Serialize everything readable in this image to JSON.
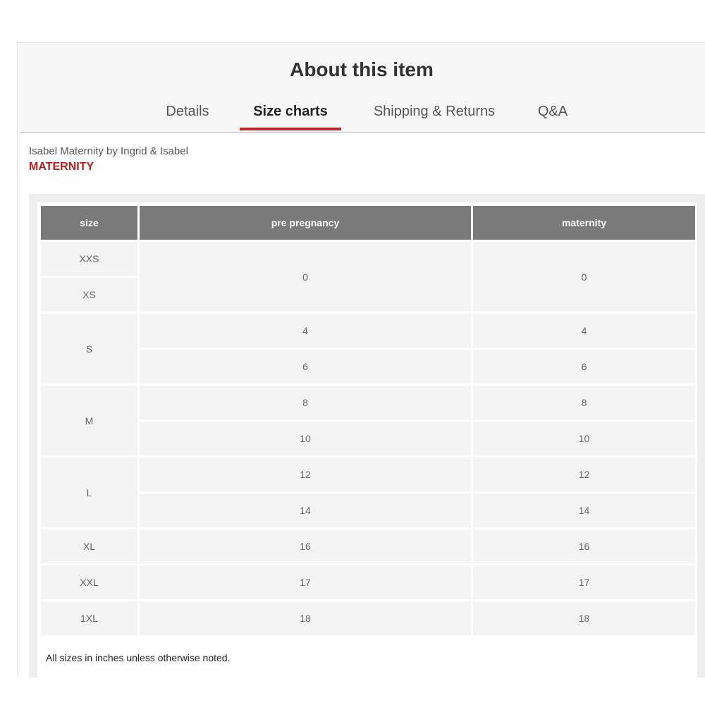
{
  "header": {
    "title": "About this item"
  },
  "tabs": [
    {
      "label": "Details",
      "active": false
    },
    {
      "label": "Size charts",
      "active": true
    },
    {
      "label": "Shipping & Returns",
      "active": false
    },
    {
      "label": "Q&A",
      "active": false
    }
  ],
  "colors": {
    "accent": "#c62828",
    "category": "#b71c1c",
    "table_header": "#7a7a7a",
    "table_cell": "#f3f3f3"
  },
  "product": {
    "brand": "Isabel Maternity by Ingrid & Isabel",
    "category": "MATERNITY"
  },
  "size_chart": {
    "columns": [
      "size",
      "pre pregnancy",
      "maternity"
    ],
    "rows": {
      "xxs": {
        "size": "XXS"
      },
      "xs": {
        "size": "XS"
      },
      "xxs_xs_pre": "0",
      "xxs_xs_mat": "0",
      "s": {
        "size": "S",
        "pre_1": "4",
        "mat_1": "4",
        "pre_2": "6",
        "mat_2": "6"
      },
      "m": {
        "size": "M",
        "pre_1": "8",
        "mat_1": "8",
        "pre_2": "10",
        "mat_2": "10"
      },
      "l": {
        "size": "L",
        "pre_1": "12",
        "mat_1": "12",
        "pre_2": "14",
        "mat_2": "14"
      },
      "xl": {
        "size": "XL",
        "pre": "16",
        "mat": "16"
      },
      "xxl": {
        "size": "XXL",
        "pre": "17",
        "mat": "17"
      },
      "x1xl": {
        "size": "1XL",
        "pre": "18",
        "mat": "18"
      }
    },
    "note": "All sizes in inches unless otherwise noted."
  }
}
